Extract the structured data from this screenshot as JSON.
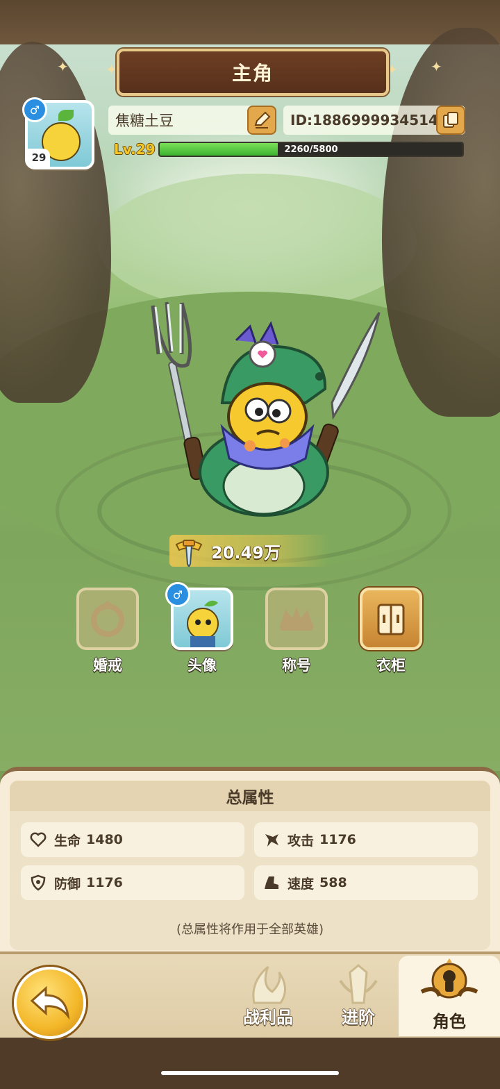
{
  "header": {
    "title": "主角"
  },
  "profile": {
    "name": "焦糖土豆",
    "id_label": "ID:1886999934514",
    "level_badge": "29",
    "level_label": "Lv.29",
    "xp": {
      "current": 2260,
      "max": 5800,
      "text": "2260/5800"
    },
    "gender_symbol": "♂"
  },
  "power": {
    "value": "20.49万"
  },
  "features": [
    {
      "label": "婚戒",
      "icon": "ring-icon",
      "state": "locked"
    },
    {
      "label": "头像",
      "icon": "avatar-icon",
      "state": "available"
    },
    {
      "label": "称号",
      "icon": "crown-icon",
      "state": "locked"
    },
    {
      "label": "衣柜",
      "icon": "wardrobe-icon",
      "state": "available"
    }
  ],
  "stats_panel": {
    "title": "总属性",
    "stats": [
      {
        "name": "生命",
        "value": "1480",
        "icon": "heart-icon"
      },
      {
        "name": "攻击",
        "value": "1176",
        "icon": "attack-icon"
      },
      {
        "name": "防御",
        "value": "1176",
        "icon": "shield-icon"
      },
      {
        "name": "速度",
        "value": "588",
        "icon": "boot-icon"
      }
    ],
    "note": "(总属性将作用于全部英雄)"
  },
  "bottom_nav": {
    "tabs": [
      {
        "label": "战利品",
        "icon": "loot-icon",
        "active": false
      },
      {
        "label": "进阶",
        "icon": "advance-icon",
        "active": false
      },
      {
        "label": "角色",
        "icon": "character-icon",
        "active": true
      }
    ]
  },
  "colors": {
    "accent_gold": "#e2a84b",
    "xp_green": "#3bb32f",
    "gender_blue": "#2a8fe0",
    "panel_bg": "#f6ecd7"
  }
}
